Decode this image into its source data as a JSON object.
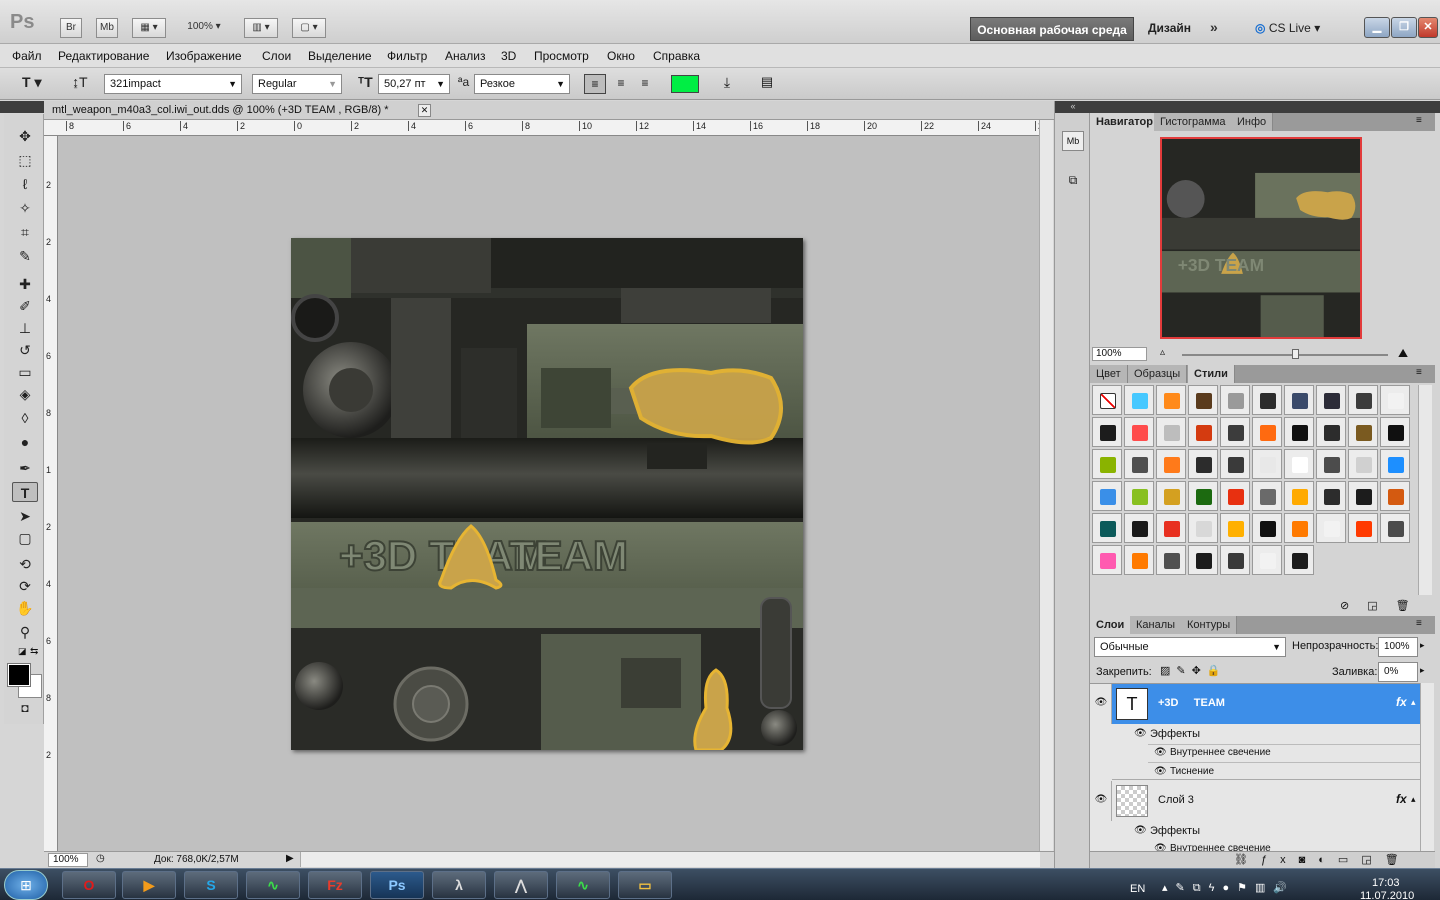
{
  "app": {
    "logo": "Ps",
    "br": "Br",
    "mb": "Mb",
    "zoom": "100%",
    "workspace": "Основная рабочая среда",
    "design": "Дизайн",
    "more": "»",
    "cslive": "CS Live"
  },
  "menu": [
    "Файл",
    "Редактирование",
    "Изображение",
    "Слои",
    "Выделение",
    "Фильтр",
    "Анализ",
    "3D",
    "Просмотр",
    "Окно",
    "Справка"
  ],
  "options": {
    "font_family": "321impact",
    "font_style": "Regular",
    "font_size": "50,27 пт",
    "aa_label": "ªa",
    "antialias": "Резкое",
    "text_color": "#00ee44"
  },
  "document": {
    "tab_title": "mtl_weapon_m40a3_col.iwi_out.dds @ 100% (+3D     TEAM , RGB/8) *",
    "ruler_top": [
      "8",
      "6",
      "4",
      "2",
      "0",
      "2",
      "4",
      "6",
      "8",
      "10",
      "12",
      "14",
      "16",
      "18",
      "20",
      "22",
      "24",
      "26"
    ],
    "ruler_left": [
      "2",
      "2",
      "4",
      "6",
      "8",
      "1",
      "2",
      "4",
      "6",
      "8",
      "2"
    ],
    "status_zoom": "100%",
    "status_doc": "Док: 768,0K/2,57M",
    "art_text": "+3D TEAM"
  },
  "navigator": {
    "tabs": [
      "Навигатор",
      "Гистограмма",
      "Инфо"
    ],
    "zoom": "100%",
    "slider": 0.55
  },
  "styles": {
    "tabs": [
      "Цвет",
      "Образцы",
      "Стили"
    ],
    "swatches": [
      "#ffffff",
      "#46c8ff",
      "#ff8a1a",
      "#5a3b1d",
      "#9a9a9a",
      "#2c2c2c",
      "#3a4a6a",
      "#2c2c38",
      "#3c3c3c",
      "#f2f2f2",
      "#1c1c1c",
      "#ff4c4c",
      "#bdbdbd",
      "#d43b10",
      "#3c3c3c",
      "#ff6a10",
      "#111111",
      "#2c2c2c",
      "#7a5a20",
      "#101010",
      "#8ab300",
      "#505050",
      "#ff7a1a",
      "#2c2c2c",
      "#3a3a3a",
      "#e8e8e8",
      "#ffffff",
      "#4c4c4c",
      "#d0d0d0",
      "#1d8fff",
      "#3a8fe8",
      "#88c020",
      "#d4a020",
      "#1c6a10",
      "#e83010",
      "#6a6a6a",
      "#ffaa00",
      "#2c2c2c",
      "#1c1c1c",
      "#d45a10",
      "#0c5a5a",
      "#1a1a1a",
      "#e83020",
      "#d8d8d8",
      "#ffb000",
      "#111111",
      "#ff7a00",
      "#f2f2f2",
      "#ff3a00",
      "#4c4c4c",
      "#ff5ab0",
      "#ff7a00",
      "#505050",
      "#1c1c1c",
      "#3a3a3a",
      "#f2f2f2",
      "#1c1c1c"
    ]
  },
  "layers": {
    "tabs": [
      "Слои",
      "Каналы",
      "Контуры"
    ],
    "blend_mode": "Обычные",
    "opacity_label": "Непрозрачность:",
    "opacity": "100%",
    "lock_label": "Закрепить:",
    "fill_label": "Заливка:",
    "fill": "0%",
    "items": [
      {
        "name": "+3D     TEAM",
        "thumb": "T",
        "fx": "fx",
        "effects_label": "Эффекты",
        "effects": [
          "Внутреннее свечение",
          "Тиснение"
        ]
      },
      {
        "name": "Слой 3",
        "fx": "fx",
        "effects_label": "Эффекты",
        "effects": [
          "Внутреннее свечение"
        ]
      }
    ]
  },
  "taskbar": {
    "lang": "EN",
    "time": "17:03",
    "date": "11.07.2010",
    "apps": [
      "Opera",
      "Media",
      "Skype",
      "Monitor",
      "FileZilla",
      "Ps",
      "Half-Life",
      "Inkscape",
      "Monitor2",
      "Explorer"
    ]
  }
}
